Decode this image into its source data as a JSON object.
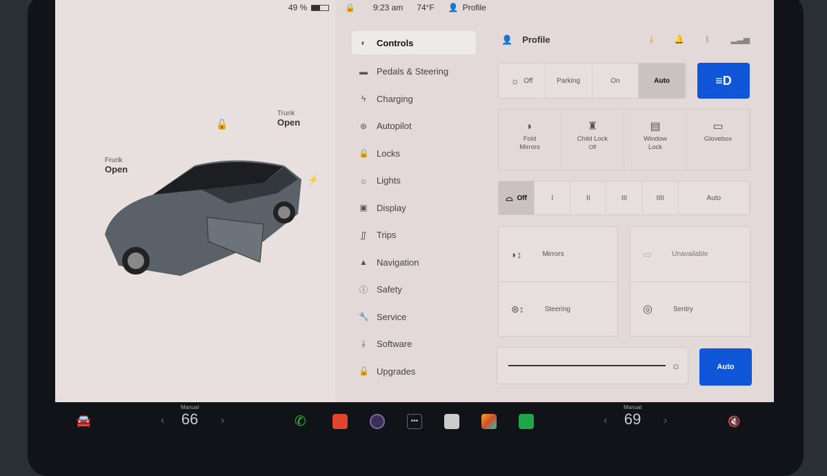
{
  "status": {
    "battery": "49 %",
    "time": "9:23 am",
    "temp": "74°F",
    "profile": "Profile"
  },
  "car": {
    "frunk_label": "Frunk",
    "frunk_state": "Open",
    "trunk_label": "Trunk",
    "trunk_state": "Open"
  },
  "menu": [
    {
      "label": "Controls",
      "icon": "toggle"
    },
    {
      "label": "Pedals & Steering",
      "icon": "car"
    },
    {
      "label": "Charging",
      "icon": "bolt"
    },
    {
      "label": "Autopilot",
      "icon": "wheel"
    },
    {
      "label": "Locks",
      "icon": "lock"
    },
    {
      "label": "Lights",
      "icon": "sun"
    },
    {
      "label": "Display",
      "icon": "display"
    },
    {
      "label": "Trips",
      "icon": "trips"
    },
    {
      "label": "Navigation",
      "icon": "nav"
    },
    {
      "label": "Safety",
      "icon": "alert"
    },
    {
      "label": "Service",
      "icon": "wrench"
    },
    {
      "label": "Software",
      "icon": "download"
    },
    {
      "label": "Upgrades",
      "icon": "bag"
    }
  ],
  "header": {
    "profile": "Profile"
  },
  "lights": {
    "options": [
      "Off",
      "Parking",
      "On",
      "Auto"
    ],
    "selected": "Auto"
  },
  "quick": [
    {
      "label": "Fold Mirrors",
      "sub": ""
    },
    {
      "label": "Child Lock",
      "sub": "Off"
    },
    {
      "label": "Window Lock",
      "sub": ""
    },
    {
      "label": "Glovebox",
      "sub": ""
    }
  ],
  "wipers": {
    "options": [
      "Off",
      "I",
      "II",
      "III",
      "IIII",
      "Auto"
    ],
    "selected": "Off"
  },
  "tiles": {
    "mirrors": "Mirrors",
    "steering": "Steering",
    "unavailable": "Unavailable",
    "sentry": "Sentry"
  },
  "brightness": {
    "auto": "Auto",
    "level": 1.0
  },
  "dock": {
    "left_mode": "Manual",
    "left_temp": "66",
    "right_mode": "Manual",
    "right_temp": "69"
  },
  "colors": {
    "accent": "#0f57d8"
  }
}
